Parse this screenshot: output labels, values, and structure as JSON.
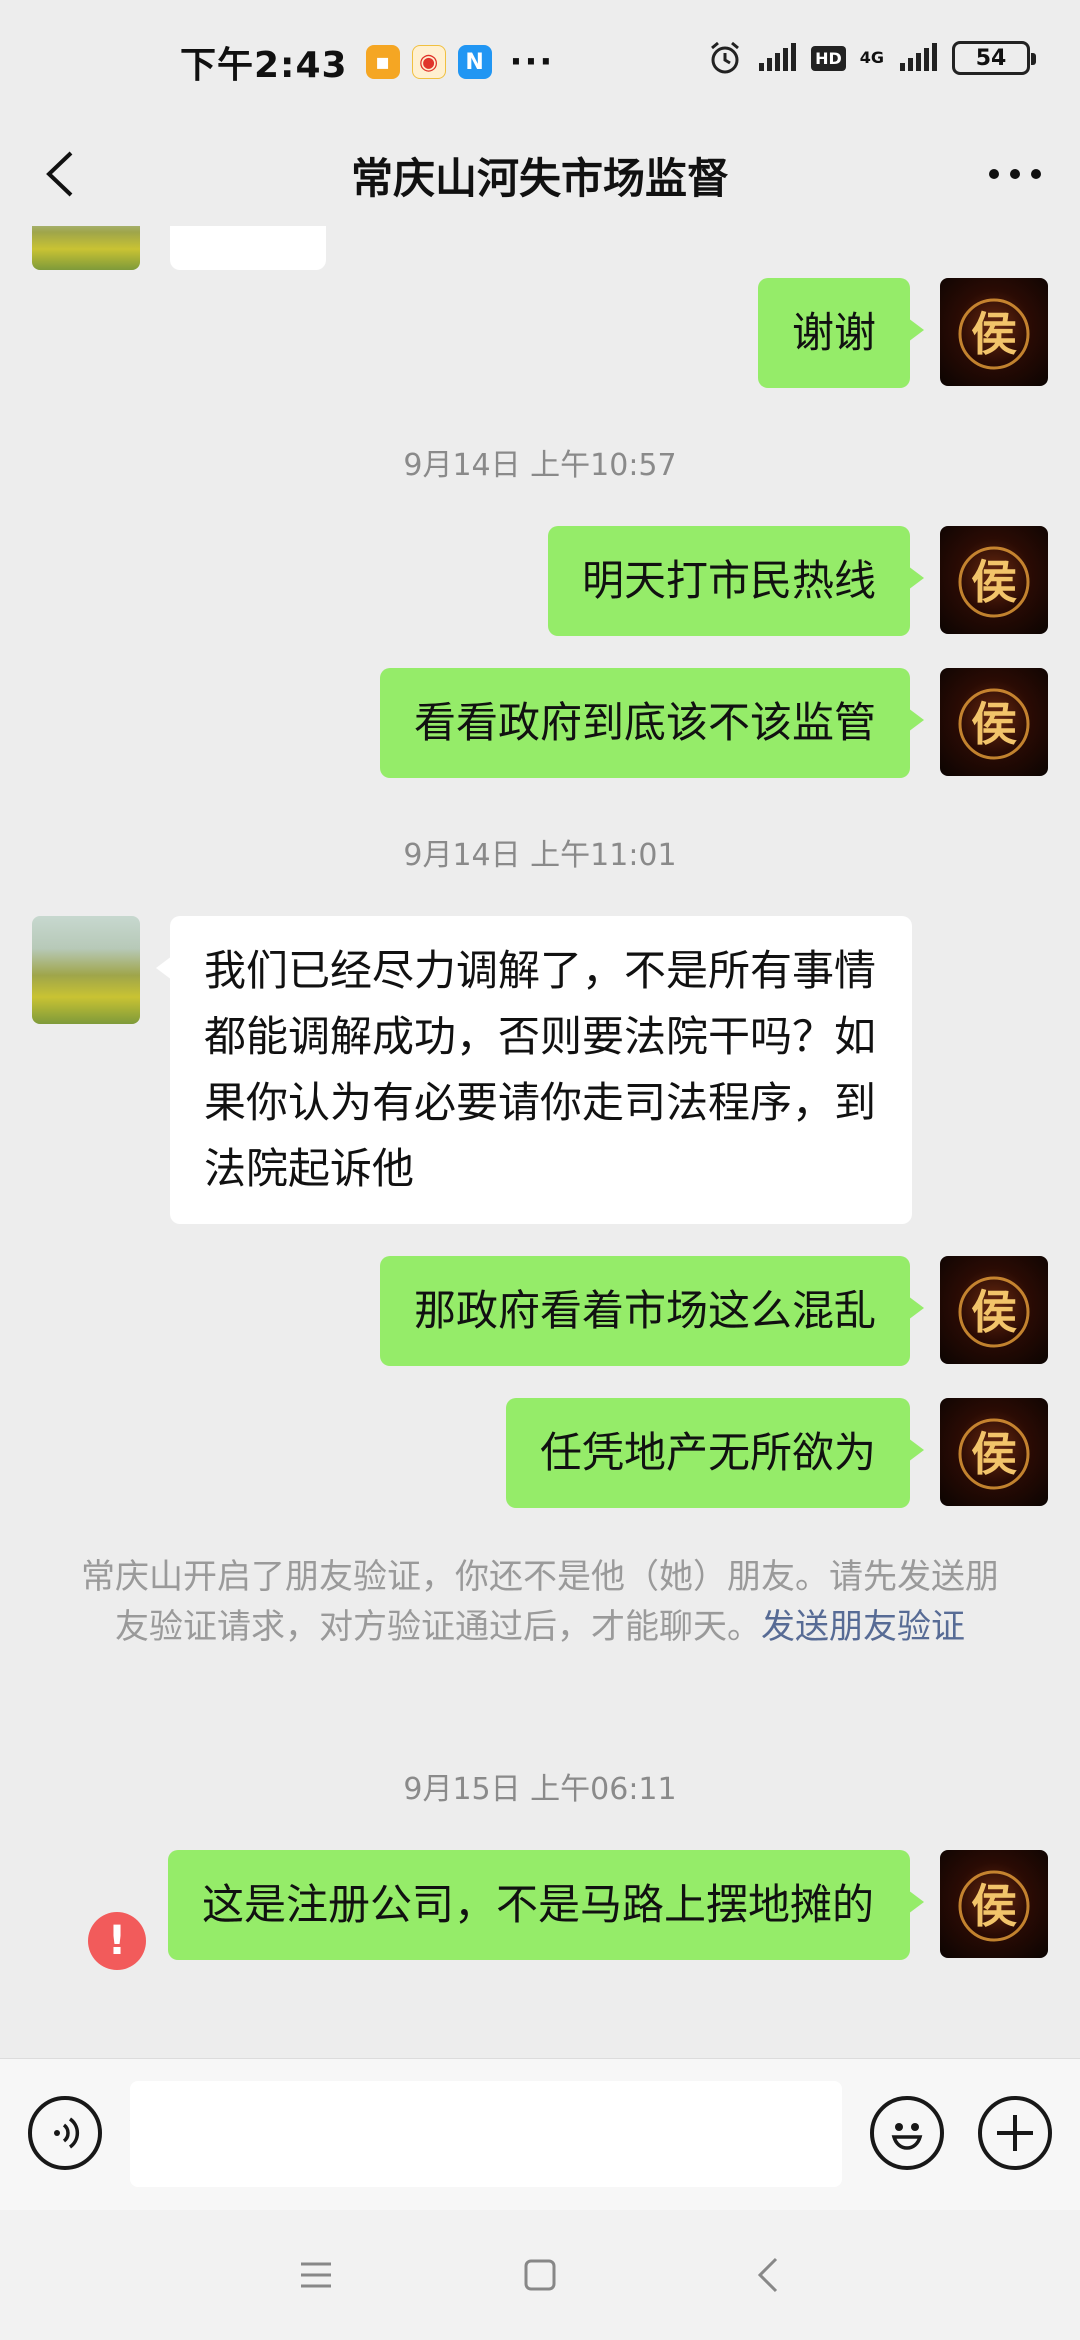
{
  "status_bar": {
    "time": "下午2:43",
    "more_dots": "···",
    "hd_label": "HD",
    "network_label": "4G",
    "battery_level": "54"
  },
  "nav": {
    "title": "常庆山河失市场监督"
  },
  "chat": {
    "messages": [
      {
        "from": "me",
        "text": "谢谢"
      },
      {
        "from": "timestamp",
        "text": "9月14日 上午10:57"
      },
      {
        "from": "me",
        "text": "明天打市民热线"
      },
      {
        "from": "me",
        "text": "看看政府到底该不该监管"
      },
      {
        "from": "timestamp",
        "text": "9月14日 上午11:01"
      },
      {
        "from": "other",
        "text": "我们已经尽力调解了，不是所有事情都能调解成功，否则要法院干吗？如果你认为有必要请你走司法程序，到法院起诉他"
      },
      {
        "from": "me",
        "text": "那政府看着市场这么混乱"
      },
      {
        "from": "me",
        "text": "任凭地产无所欲为"
      },
      {
        "from": "system",
        "text": "常庆山开启了朋友验证，你还不是他（她）朋友。请先发送朋友验证请求，对方验证通过后，才能聊天。",
        "link": "发送朋友验证"
      },
      {
        "from": "timestamp",
        "text": "9月15日 上午06:11"
      },
      {
        "from": "me",
        "text": "这是注册公司，不是马路上摆地摊的",
        "failed": true
      }
    ],
    "avatar_glyph": "侯"
  },
  "colors": {
    "bubble_me": "#95ec69",
    "bubble_other": "#ffffff",
    "link": "#576b95",
    "error": "#f25b5b"
  }
}
